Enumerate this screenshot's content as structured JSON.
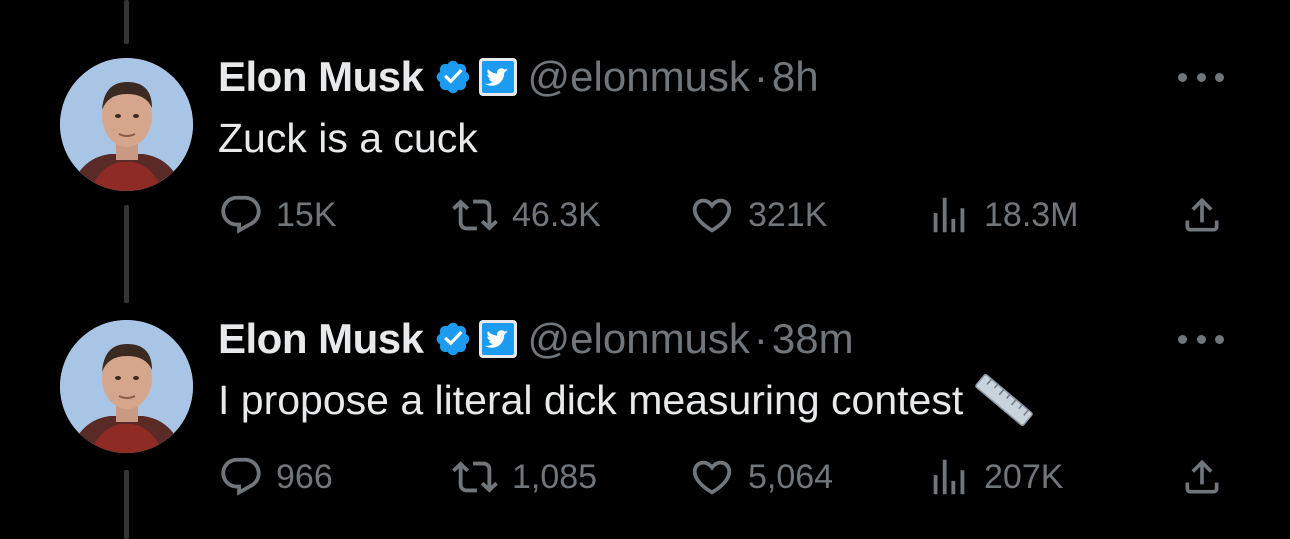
{
  "tweets": [
    {
      "author_name": "Elon Musk",
      "handle": "@elonmusk",
      "separator": "·",
      "time": "8h",
      "text": "Zuck is a cuck",
      "emoji": "",
      "stats": {
        "replies": "15K",
        "retweets": "46.3K",
        "likes": "321K",
        "views": "18.3M"
      }
    },
    {
      "author_name": "Elon Musk",
      "handle": "@elonmusk",
      "separator": "·",
      "time": "38m",
      "text": "I propose a literal dick measuring contest",
      "emoji": "straight-ruler",
      "stats": {
        "replies": "966",
        "retweets": "1,085",
        "likes": "5,064",
        "views": "207K"
      }
    }
  ],
  "colors": {
    "background": "#000000",
    "primary_text": "#e7e9ea",
    "secondary_text": "#71767b",
    "verified_blue": "#1d9bf0",
    "thread_line": "#333639"
  },
  "icons": {
    "reply": "reply-bubble-icon",
    "retweet": "retweet-icon",
    "like": "heart-icon",
    "views": "views-chart-icon",
    "share": "share-upload-icon",
    "more": "more-dots-icon",
    "verified": "verified-badge-icon",
    "affiliation": "twitter-bird-badge-icon"
  }
}
